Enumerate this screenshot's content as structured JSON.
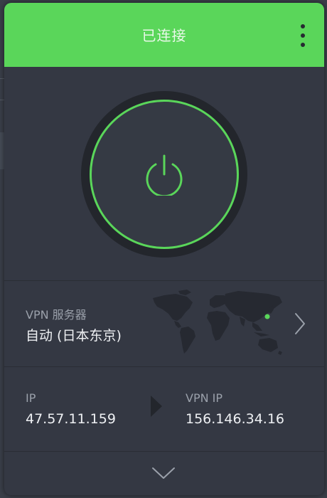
{
  "header": {
    "title": "已连接",
    "menu_icon": "more-vertical-icon"
  },
  "power": {
    "icon": "power-icon",
    "state": "connected"
  },
  "server": {
    "label": "VPN 服务器",
    "value": "自动 (日本东京)",
    "map_icon": "world-map-icon",
    "chevron_icon": "chevron-right-icon"
  },
  "ip": {
    "local_label": "IP",
    "local_value": "47.57.11.159",
    "vpn_label": "VPN IP",
    "vpn_value": "156.146.34.16",
    "arrow_icon": "arrow-right-icon"
  },
  "footer": {
    "expand_icon": "chevron-down-icon"
  },
  "colors": {
    "accent": "#5ad65a",
    "header_bg": "#5ad65a",
    "panel_bg": "#343843",
    "ring_bg": "#23262c",
    "label_text": "#9aa0aa",
    "value_text": "#eef0f3",
    "map_land": "#262931"
  }
}
